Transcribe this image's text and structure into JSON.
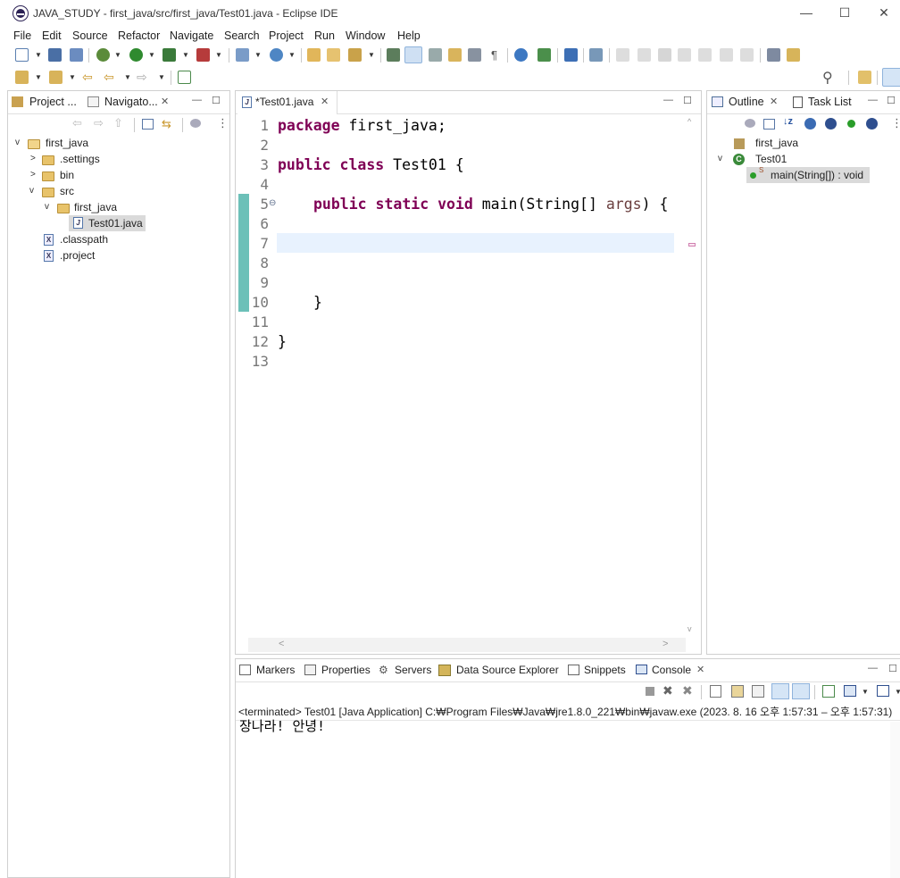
{
  "window": {
    "title": "JAVA_STUDY - first_java/src/first_java/Test01.java - Eclipse IDE",
    "minimize": "—",
    "maximize": "☐",
    "close": "✕"
  },
  "menu": [
    "File",
    "Edit",
    "Source",
    "Refactor",
    "Navigate",
    "Search",
    "Project",
    "Run",
    "Window",
    "Help"
  ],
  "left_panel": {
    "tabs": [
      {
        "label": "Project ...",
        "icon": "package-explorer-icon"
      },
      {
        "label": "Navigato...",
        "icon": "navigator-icon",
        "close": "✕"
      }
    ],
    "tree": [
      {
        "label": "first_java",
        "type": "project",
        "expanded": true
      },
      {
        "label": ".settings",
        "type": "folder",
        "expanded": false
      },
      {
        "label": "bin",
        "type": "folder",
        "expanded": false
      },
      {
        "label": "src",
        "type": "folder",
        "expanded": true
      },
      {
        "label": "first_java",
        "type": "folder",
        "expanded": true
      },
      {
        "label": "Test01.java",
        "type": "java-file",
        "selected": true
      },
      {
        "label": ".classpath",
        "type": "xml-file"
      },
      {
        "label": ".project",
        "type": "xml-file"
      }
    ]
  },
  "editor": {
    "tab_label": "*Test01.java",
    "tab_close": "✕",
    "line_numbers": [
      "1",
      "2",
      "3",
      "4",
      "5",
      "6",
      "7",
      "8",
      "9",
      "10",
      "11",
      "12",
      "13"
    ],
    "lines": {
      "l1_kw": "package",
      "l1_rest": " first_java;",
      "l3_kw": "public class",
      "l3_rest": " Test01 {",
      "l5_kw": "public static void",
      "l5_mid": " main(String[] ",
      "l5_arg": "args",
      "l5_end": ") {",
      "l10": "}",
      "l12": "}"
    },
    "fold_marker": "⊖",
    "current_line": "7"
  },
  "right_panel": {
    "tabs": [
      {
        "label": "Outline",
        "close": "✕"
      },
      {
        "label": "Task List"
      }
    ],
    "tree": [
      {
        "label": "first_java",
        "type": "package"
      },
      {
        "label": "Test01",
        "type": "class",
        "expanded": true
      },
      {
        "label": "main(String[]) : void",
        "type": "method",
        "modifier": "S",
        "selected": true
      }
    ]
  },
  "bottom_panel": {
    "tabs": [
      {
        "label": "Markers"
      },
      {
        "label": "Properties"
      },
      {
        "label": "Servers"
      },
      {
        "label": "Data Source Explorer"
      },
      {
        "label": "Snippets"
      },
      {
        "label": "Console",
        "active": true,
        "close": "✕"
      }
    ],
    "status": "<terminated> Test01 [Java Application] C:₩Program Files₩Java₩jre1.8.0_221₩bin₩javaw.exe  (2023. 8. 16 오후 1:57:31 – 오후 1:57:31)",
    "output": "장나라! 안녕!"
  },
  "colors": {
    "keyword": "#7f0055",
    "argument": "#6a3e3e",
    "current_line_bg": "#e8f2fe",
    "change_bar": "#6cc0b8"
  }
}
